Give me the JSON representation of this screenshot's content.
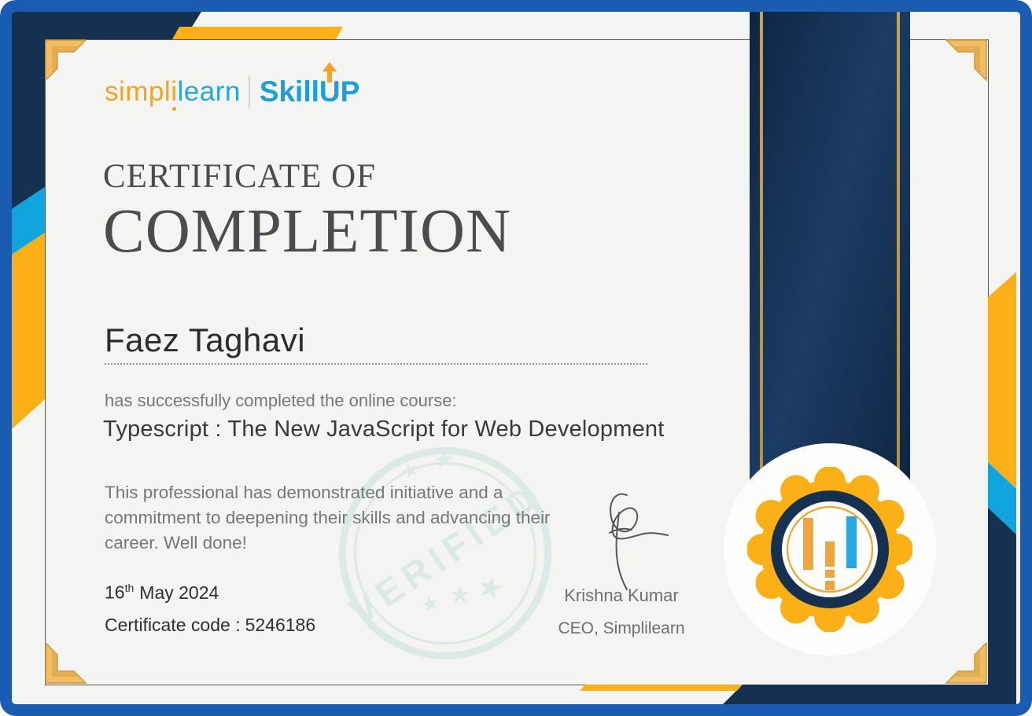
{
  "brand": {
    "logo_orange_text": "simpl",
    "logo_i": "i",
    "logo_blue_text": "learn",
    "skillup_prefix": "Skill",
    "skillup_u": "U",
    "skillup_suffix": "P"
  },
  "title": {
    "line1": "CERTIFICATE OF",
    "line2": "COMPLETION"
  },
  "recipient_name": "Faez Taghavi",
  "course": {
    "intro": "has successfully completed the online course:",
    "name": "Typescript : The New JavaScript for Web Development"
  },
  "description": "This professional has demonstrated initiative and a commitment to deepening their skills and advancing their career. Well done!",
  "issued": {
    "date_day": "16",
    "date_ordinal": "th",
    "date_month_year": "May 2024",
    "code_label": "Certificate code :",
    "code_value": "5246186"
  },
  "signatory": {
    "name": "Krishna Kumar",
    "title": "CEO, Simplilearn"
  },
  "stamp": {
    "text": "VERIFIED",
    "star_glyph": "★"
  },
  "colors": {
    "frame_blue": "#1a5cb2",
    "navy": "#16304f",
    "cyan": "#11a5de",
    "amber": "#fcb017",
    "gold_ornament": "#f0bd63",
    "paper": "#f4f4f2",
    "stamp_teal": "#d9e9e6",
    "logo_orange": "#f5a325",
    "logo_blue": "#2aa5de",
    "title_gray": "#4c4c4e",
    "body_gray": "#76777b",
    "text_dark": "#2f2f31"
  }
}
